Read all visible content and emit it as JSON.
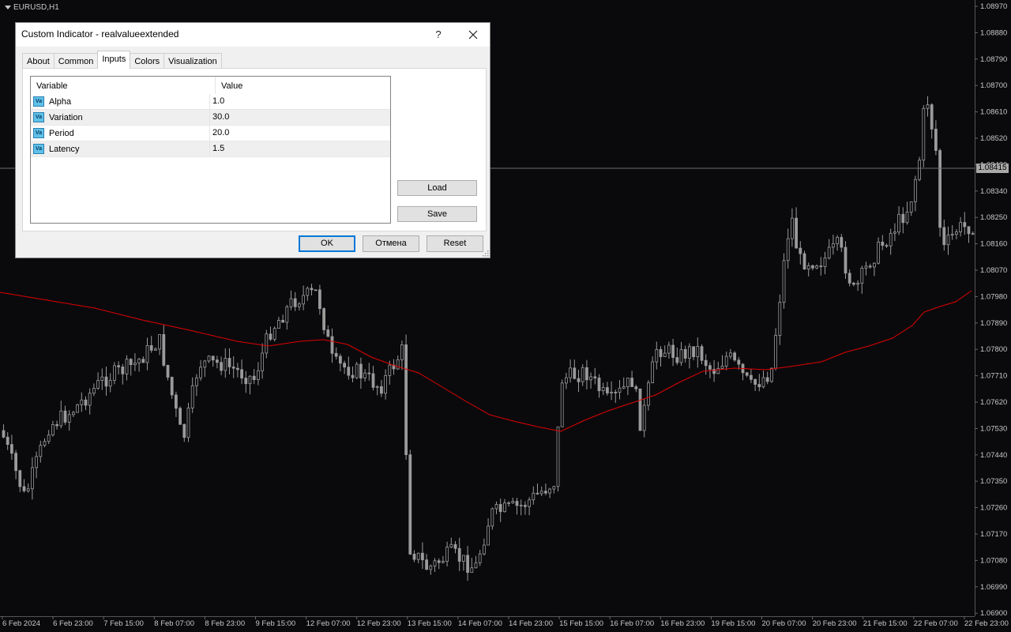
{
  "chart": {
    "symbol": "EURUSD,H1",
    "current_price": "1.08415",
    "price_ticks": [
      "1.08970",
      "1.08880",
      "1.08790",
      "1.08700",
      "1.08610",
      "1.08520",
      "1.08430",
      "1.08340",
      "1.08250",
      "1.08160",
      "1.08070",
      "1.07980",
      "1.07890",
      "1.07800",
      "1.07710",
      "1.07620",
      "1.07530",
      "1.07440",
      "1.07350",
      "1.07260",
      "1.07170",
      "1.07080",
      "1.06990",
      "1.06900"
    ],
    "time_ticks": [
      "6 Feb 2024",
      "6 Feb 23:00",
      "7 Feb 15:00",
      "8 Feb 07:00",
      "8 Feb 23:00",
      "9 Feb 15:00",
      "12 Feb 07:00",
      "12 Feb 23:00",
      "13 Feb 15:00",
      "14 Feb 07:00",
      "14 Feb 23:00",
      "15 Feb 15:00",
      "16 Feb 07:00",
      "16 Feb 23:00",
      "19 Feb 15:00",
      "20 Feb 07:00",
      "20 Feb 23:00",
      "21 Feb 15:00",
      "22 Feb 07:00",
      "22 Feb 23:00"
    ],
    "colors": {
      "background": "#0a0a0d",
      "candles": "#9a9a9a",
      "indicator": "#e00000",
      "axis_text": "#c8c8c8"
    }
  },
  "dialog": {
    "title": "Custom Indicator - realvalueextended",
    "help": "?",
    "tabs": [
      {
        "label": "About"
      },
      {
        "label": "Common"
      },
      {
        "label": "Inputs",
        "active": true
      },
      {
        "label": "Colors"
      },
      {
        "label": "Visualization"
      }
    ],
    "grid": {
      "headers": {
        "variable": "Variable",
        "value": "Value"
      },
      "icon": "Va",
      "rows": [
        {
          "variable": "Alpha",
          "value": "1.0"
        },
        {
          "variable": "Variation",
          "value": "30.0"
        },
        {
          "variable": "Period",
          "value": "20.0"
        },
        {
          "variable": "Latency",
          "value": "1.5"
        }
      ]
    },
    "side_buttons": {
      "load": "Load",
      "save": "Save"
    },
    "buttons": {
      "ok": "OK",
      "cancel": "Отмена",
      "reset": "Reset"
    }
  }
}
